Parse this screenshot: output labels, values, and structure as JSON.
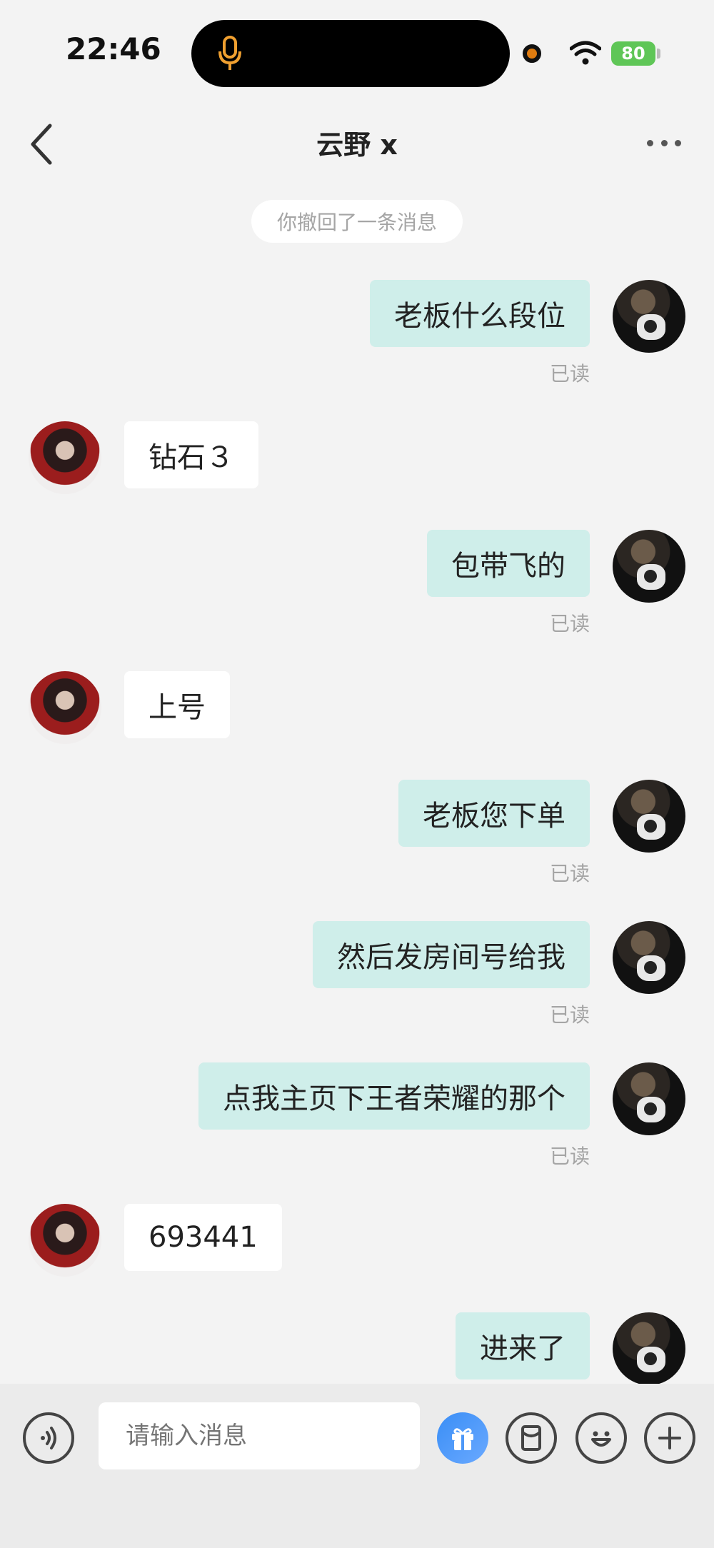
{
  "status_bar": {
    "time": "22:46",
    "battery": "80"
  },
  "header": {
    "title": "云野 x"
  },
  "system_notice": "你撤回了一条消息",
  "messages": [
    {
      "side": "right",
      "text": "老板什么段位",
      "status": "已读"
    },
    {
      "side": "left",
      "text": "钻石３"
    },
    {
      "side": "right",
      "text": "包带飞的",
      "status": "已读"
    },
    {
      "side": "left",
      "text": "上号"
    },
    {
      "side": "right",
      "text": "老板您下单",
      "status": "已读"
    },
    {
      "side": "right",
      "text": "然后发房间号给我",
      "status": "已读"
    },
    {
      "side": "right",
      "text": "点我主页下王者荣耀的那个",
      "status": "已读"
    },
    {
      "side": "left",
      "text": "693441"
    },
    {
      "side": "right",
      "text": "进来了"
    }
  ],
  "input": {
    "placeholder": "请输入消息"
  },
  "icons": {
    "voice": "voice-icon",
    "gift": "gift-icon",
    "red_packet": "red-packet-icon",
    "emoji": "emoji-icon",
    "plus": "plus-icon"
  },
  "colors": {
    "my_bubble": "#cfeeea",
    "their_bubble": "#ffffff",
    "background": "#f3f3f3"
  }
}
